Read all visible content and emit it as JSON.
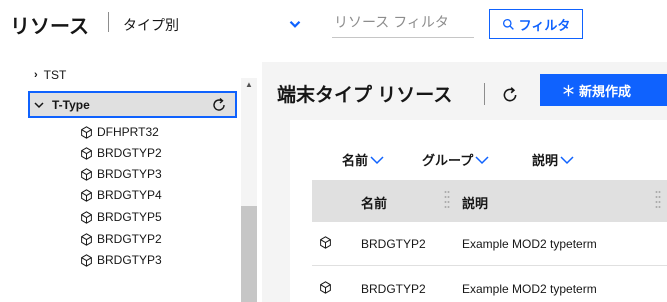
{
  "header": {
    "title": "リソース",
    "type_select": {
      "value": "タイプ別",
      "icon": "chevron-down-icon"
    },
    "filter_input": {
      "placeholder": "リソース フィルタ",
      "value": ""
    },
    "filter_button": {
      "label": "フィルタ",
      "icon": "search-icon"
    }
  },
  "tree": {
    "top_item": "TST",
    "selected": {
      "label": "T-Type",
      "icon": "refresh-icon"
    },
    "children": [
      "DFHPRT32",
      "BRDGTYP2",
      "BRDGTYP3",
      "BRDGTYP4",
      "BRDGTYP5",
      "BRDGTYP2",
      "BRDGTYP3"
    ]
  },
  "content": {
    "title": "端末タイプ リソース",
    "new_button": {
      "label": "新規作成",
      "icon": "asterisk-icon"
    },
    "sort_options": [
      "名前",
      "グループ",
      "説明"
    ],
    "table": {
      "headers": [
        "名前",
        "説明"
      ],
      "rows": [
        {
          "name": "BRDGTYP2",
          "description": "Example MOD2 typeterm"
        },
        {
          "name": "BRDGTYP2",
          "description": "Example MOD2 typeterm"
        }
      ]
    }
  },
  "colors": {
    "accent": "#0f62fe",
    "panel": "#f4f4f4",
    "selected_bg": "#e0e0e0"
  }
}
